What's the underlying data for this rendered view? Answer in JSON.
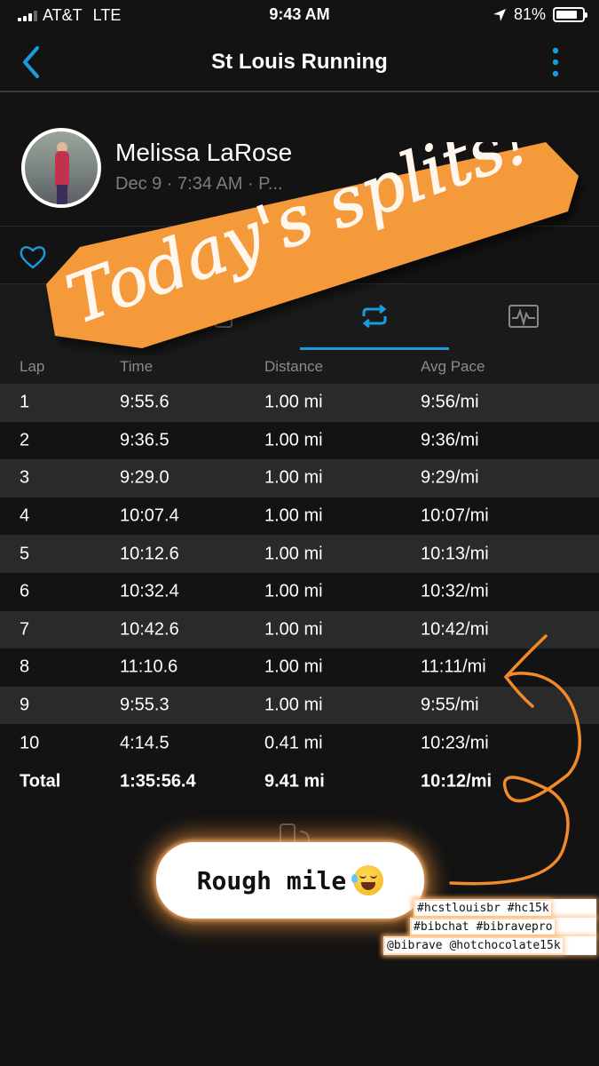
{
  "status_bar": {
    "carrier": "AT&T",
    "network": "LTE",
    "time": "9:43 AM",
    "battery": "81%",
    "battery_level": 0.81
  },
  "header": {
    "title": "St Louis Running"
  },
  "profile": {
    "name": "Melissa LaRose",
    "subtitle": "Dec 9 · 7:34 AM · P..."
  },
  "table": {
    "headers": [
      "Lap",
      "Time",
      "Distance",
      "Avg Pace"
    ],
    "rows": [
      {
        "lap": "1",
        "time": "9:55.6",
        "distance": "1.00 mi",
        "pace": "9:56/mi"
      },
      {
        "lap": "2",
        "time": "9:36.5",
        "distance": "1.00 mi",
        "pace": "9:36/mi"
      },
      {
        "lap": "3",
        "time": "9:29.0",
        "distance": "1.00 mi",
        "pace": "9:29/mi"
      },
      {
        "lap": "4",
        "time": "10:07.4",
        "distance": "1.00 mi",
        "pace": "10:07/mi"
      },
      {
        "lap": "5",
        "time": "10:12.6",
        "distance": "1.00 mi",
        "pace": "10:13/mi"
      },
      {
        "lap": "6",
        "time": "10:32.4",
        "distance": "1.00 mi",
        "pace": "10:32/mi"
      },
      {
        "lap": "7",
        "time": "10:42.6",
        "distance": "1.00 mi",
        "pace": "10:42/mi"
      },
      {
        "lap": "8",
        "time": "11:10.6",
        "distance": "1.00 mi",
        "pace": "11:11/mi"
      },
      {
        "lap": "9",
        "time": "9:55.3",
        "distance": "1.00 mi",
        "pace": "9:55/mi"
      },
      {
        "lap": "10",
        "time": "4:14.5",
        "distance": "0.41 mi",
        "pace": "10:23/mi"
      }
    ],
    "total": {
      "lap": "Total",
      "time": "1:35:56.4",
      "distance": "9.41 mi",
      "pace": "10:12/mi"
    }
  },
  "overlay": {
    "sticker_text": "Today's splits!",
    "note_text": "Rough mile",
    "hashtags": [
      "#hcstlouisbr #hc15k",
      "#bibchat #bibravepro",
      "@bibrave @hotchocolate15k"
    ]
  },
  "colors": {
    "accent": "#1a9be0",
    "sticker": "#f59a3a",
    "background": "#131313"
  },
  "icons": {
    "back": "chevron-left-icon",
    "menu": "vertical-dots-icon",
    "like": "heart-icon",
    "laps": "repeat-icon",
    "chart": "activity-chart-icon"
  }
}
